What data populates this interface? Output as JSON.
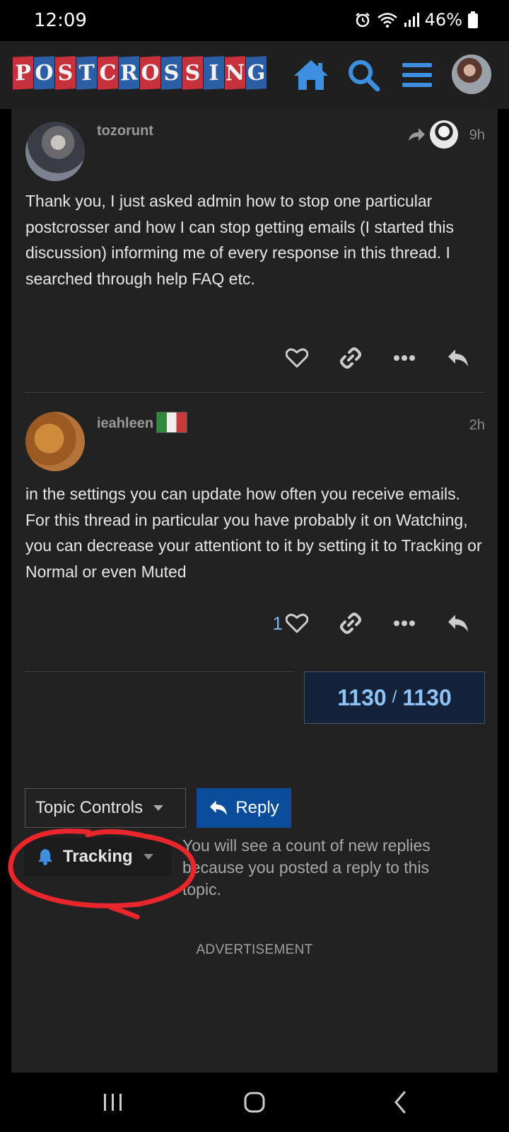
{
  "status_bar": {
    "time": "12:09",
    "battery": "46%"
  },
  "header": {
    "logo_letters": [
      "P",
      "O",
      "S",
      "T",
      "C",
      "R",
      "O",
      "S",
      "S",
      "I",
      "N",
      "G"
    ],
    "logo_colors": [
      "red",
      "blue",
      "red",
      "blue",
      "red",
      "blue",
      "red",
      "blue",
      "red",
      "blue",
      "red",
      "blue"
    ],
    "brand_blue": "#3f8fe0",
    "brand_red": "#c7313b"
  },
  "posts": [
    {
      "username": "tozorunt",
      "time": "9h",
      "body": "Thank you, I just asked admin how to stop one particular postcrosser and how I can stop getting emails (I started this discussion) informing me of every response in this thread. I searched through help FAQ etc.",
      "like_count": "",
      "icons": [
        "heart-icon",
        "link-icon",
        "more-icon",
        "reply-icon"
      ]
    },
    {
      "username": "ieahleen",
      "flag": "italy-flag",
      "time": "2h",
      "body": "in the settings you can update how often you receive emails. For this thread in particular you have probably it on Watching, you can decrease your attentiont to it by setting it to Tracking or Normal or even Muted",
      "like_count": "1",
      "icons": [
        "heart-icon",
        "link-icon",
        "more-icon",
        "reply-icon"
      ]
    }
  ],
  "progress": {
    "current": "1130",
    "separator": "/",
    "total": "1130"
  },
  "controls": {
    "topic_controls_label": "Topic Controls",
    "reply_label": "Reply",
    "tracking_label": "Tracking",
    "tracking_description": "You will see a count of new replies because you posted a reply to this topic."
  },
  "advertisement_label": "ADVERTISEMENT",
  "colors": {
    "background": "#222222",
    "accent_blue": "#0b4d9a",
    "progress_text": "#8fc3f5",
    "annotation_red": "#e8262c"
  }
}
